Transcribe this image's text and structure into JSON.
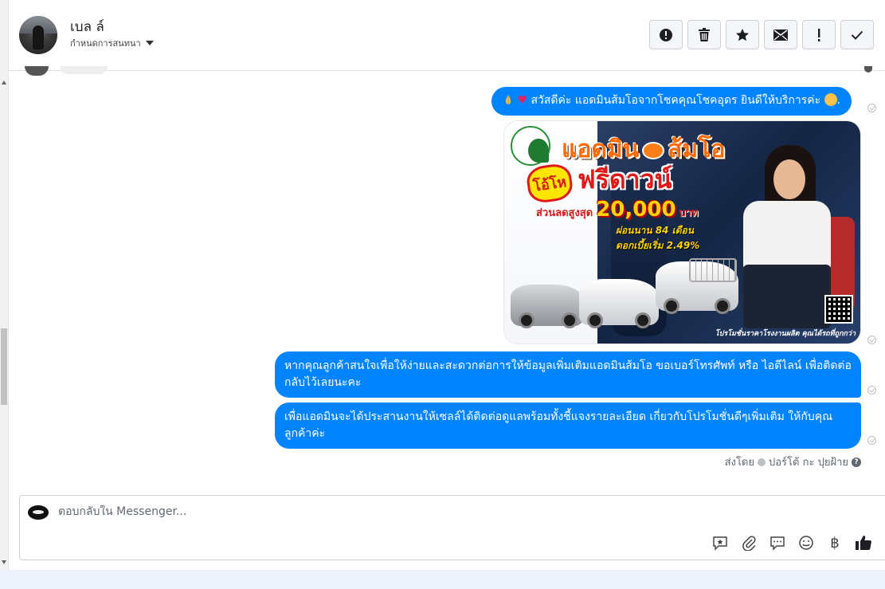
{
  "header": {
    "contact_name": "เบล ล์",
    "conversation_settings": "กำหนดการสนทนา",
    "toolbar": {
      "spam_icon": "exclamation-circle-icon",
      "delete_icon": "trash-icon",
      "star_icon": "star-icon",
      "unread_icon": "envelope-icon",
      "important_icon": "exclamation-icon",
      "done_icon": "checkmark-icon"
    }
  },
  "messages": [
    {
      "id": "msg1",
      "text": "สวัสดีค่ะ แอดมินส้มโอจากโชคคุณโชคอุดร ยินดีให้บริการค่ะ",
      "suffix": "."
    },
    {
      "id": "msg2",
      "type": "image",
      "promo": {
        "headline_left": "แอดมิน",
        "headline_right": "ส้มโอ",
        "burst": "โอ้โห",
        "free_down": "ฟรีดาวน์",
        "discount_label": "ส่วนลดสูงสุด",
        "discount_amount": "20,000",
        "discount_unit": "บาท",
        "installment_line1": "ผ่อนนาน 84 เดือน",
        "installment_line2": "ดอกเบี้ยเริ่ม 2.49%",
        "footer_note": "โปรโมชั่นราคาโรงงานผลิต คุณได้รถที่ถูกกว่า"
      }
    },
    {
      "id": "msg3",
      "text": "หากคุณลูกค้าสนใจเพื่อให้ง่ายและสะดวกต่อการให้ข้อมูลเพิ่มเติมแอดมินส้มโอ ขอเบอร์โทรศัพท์ หรือ ไอดีไลน์ เพื่อติดต่อกลับไว้เลยนะคะ"
    },
    {
      "id": "msg4",
      "text": "เพื่อแอดมินจะได้ประสานงานให้เซลล์ได้ติดต่อดูแลพร้อมทั้งชี้แจงรายละเอียด เกี่ยวกับโปรโมชั่นดีๆเพิ่มเติม ให้กับคุณลูกค้าค่ะ"
    }
  ],
  "sent_by": {
    "prefix": "ส่งโดย",
    "name": "ปอร์โต้ กะ ปุยฝ้าย",
    "help": "?"
  },
  "composer": {
    "placeholder": "ตอบกลับใน Messenger...",
    "tools": [
      "saved-reply-icon",
      "attachment-icon",
      "chat-bubble-icon",
      "emoji-icon",
      "baht-icon",
      "thumbs-up-icon"
    ],
    "baht_symbol": "฿"
  },
  "colors": {
    "bubble": "#0084ff",
    "header_border": "#dddfe2",
    "bottom_bar": "#eef3fb"
  }
}
